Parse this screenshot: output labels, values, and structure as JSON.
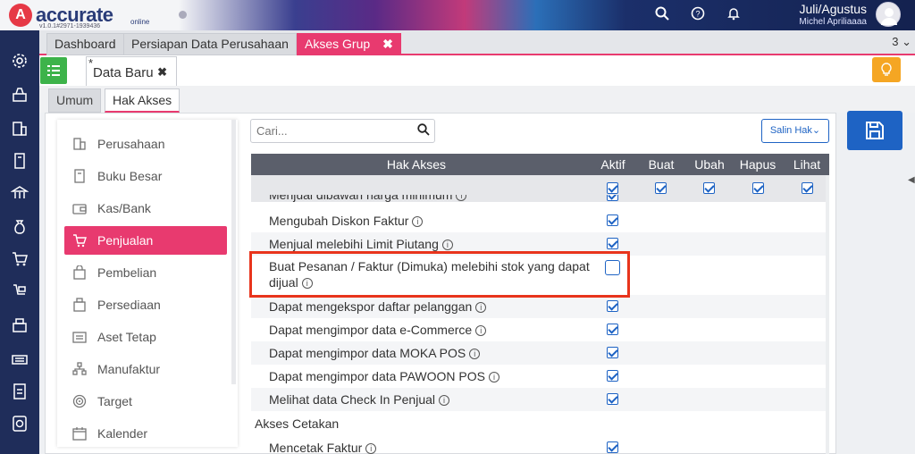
{
  "app": {
    "logo_letter": "A",
    "logo_text": "accurate",
    "logo_suffix": "online",
    "version": "v1.0.1#2971-1939436",
    "period": "Juli/Agustus",
    "user": "Michel Apriliaaaa"
  },
  "topbar_icons": [
    "search-icon",
    "help-icon",
    "bell-icon"
  ],
  "tabs": [
    {
      "label": "Dashboard"
    },
    {
      "label": "Persiapan Data Perusahaan"
    },
    {
      "label": "Akses Grup",
      "close": "✖"
    }
  ],
  "tab_count": "3 ⌄",
  "doc_tab": {
    "star": "*",
    "label": "Data Baru",
    "close": "✖"
  },
  "form_tabs": [
    "Umum",
    "Hak Akses"
  ],
  "submenu": [
    {
      "label": "Perusahaan",
      "icon": "building-icon"
    },
    {
      "label": "Buku Besar",
      "icon": "book-icon"
    },
    {
      "label": "Kas/Bank",
      "icon": "wallet-icon"
    },
    {
      "label": "Penjualan",
      "icon": "cart-icon"
    },
    {
      "label": "Pembelian",
      "icon": "shopping-bag-icon"
    },
    {
      "label": "Persediaan",
      "icon": "box-icon"
    },
    {
      "label": "Aset Tetap",
      "icon": "asset-icon"
    },
    {
      "label": "Manufaktur",
      "icon": "factory-icon"
    },
    {
      "label": "Target",
      "icon": "target-icon"
    },
    {
      "label": "Kalender",
      "icon": "calendar-icon"
    }
  ],
  "search": {
    "placeholder": "Cari..."
  },
  "salin_button": "Salin Hak⌄",
  "table": {
    "headers": [
      "Hak Akses",
      "Aktif",
      "Buat",
      "Ubah",
      "Hapus",
      "Lihat"
    ],
    "partial_row": "Menjual dibawah harga minimum",
    "rows": [
      {
        "label": "Mengubah Diskon Faktur",
        "checked": true
      },
      {
        "label": "Menjual melebihi Limit Piutang",
        "checked": true
      },
      {
        "label": "Buat Pesanan / Faktur (Dimuka) melebihi stok yang dapat",
        "label2": "dijual",
        "checked": false
      },
      {
        "label": "Dapat mengekspor daftar pelanggan",
        "checked": true
      },
      {
        "label": "Dapat mengimpor data e-Commerce",
        "checked": true
      },
      {
        "label": "Dapat mengimpor data MOKA POS",
        "checked": true
      },
      {
        "label": "Dapat mengimpor data PAWOON POS",
        "checked": true
      },
      {
        "label": "Melihat data Check In Penjual",
        "checked": true
      }
    ],
    "section": "Akses Cetakan",
    "print_rows": [
      {
        "label": "Mencetak Faktur",
        "checked": true
      }
    ],
    "info_glyph": "i"
  },
  "colors": {
    "accent": "#e83a6f",
    "primary": "#1e63c4",
    "nav": "#1f2d5a",
    "highlight": "#e8341c"
  }
}
